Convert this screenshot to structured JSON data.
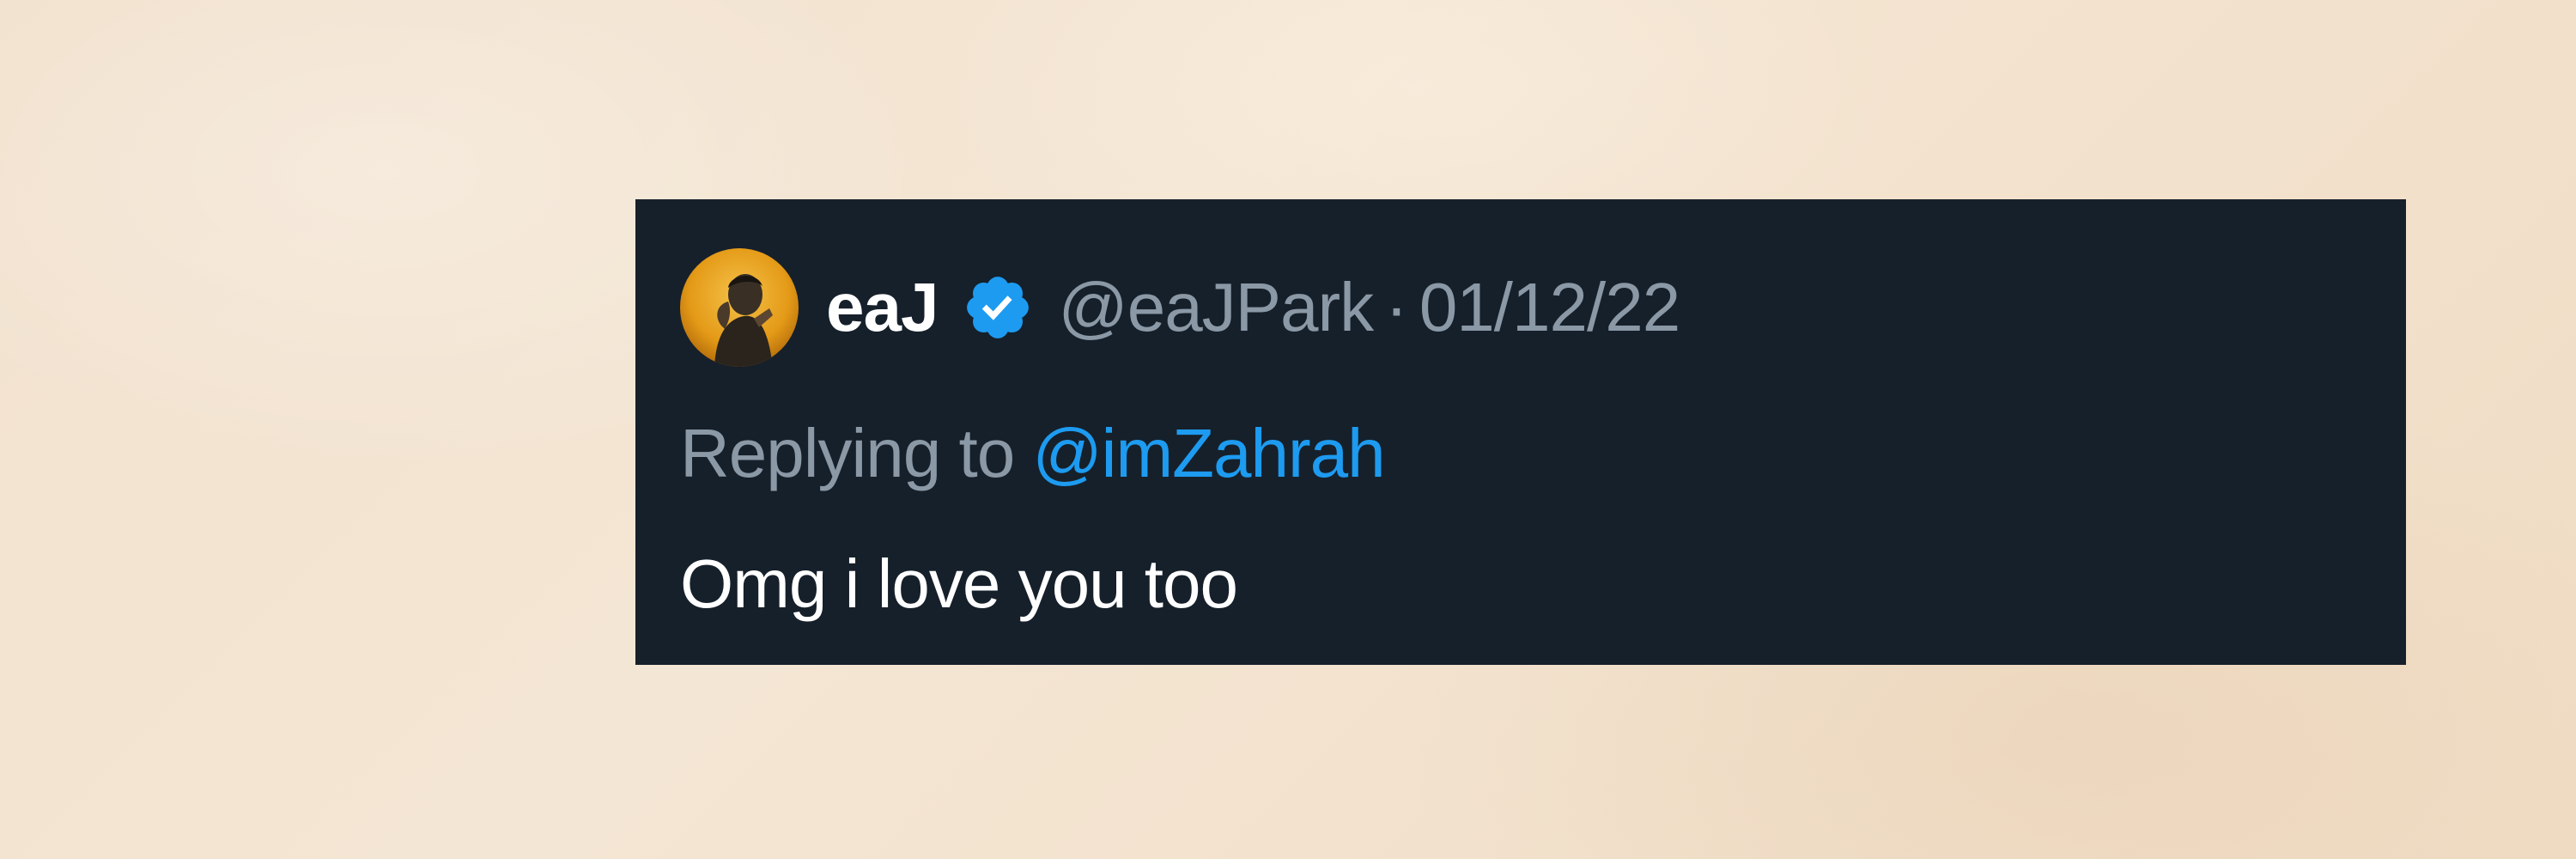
{
  "tweet": {
    "author": {
      "display_name": "eaJ",
      "handle": "@eaJPark",
      "verified": true,
      "verified_icon": "verified-badge-icon",
      "avatar_icon": "avatar"
    },
    "separator": "·",
    "date": "01/12/22",
    "replying_to_label": "Replying to",
    "replying_to_handle": "@imZahrah",
    "text": "Omg i love you too"
  },
  "colors": {
    "card_background": "#16202b",
    "primary_text": "#ffffff",
    "secondary_text": "#8b98a5",
    "link": "#1d9bf0",
    "page_background": "#f2e2cf"
  }
}
